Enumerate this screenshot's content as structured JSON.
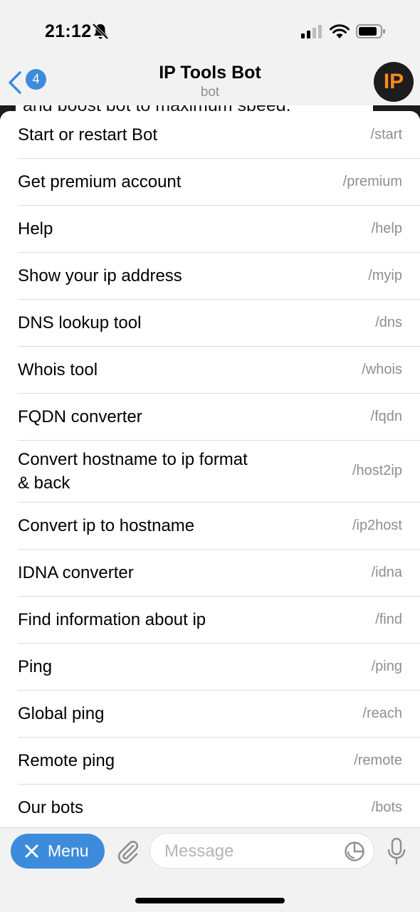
{
  "status_bar": {
    "time": "21:12"
  },
  "header": {
    "back_count": "4",
    "title": "IP Tools Bot",
    "subtitle": "bot",
    "avatar_text": "IP"
  },
  "chat_peek_text": "and boost bot to maximum speed.",
  "commands": [
    {
      "description": "Start or restart Bot",
      "command": "/start"
    },
    {
      "description": "Get premium account",
      "command": "/premium"
    },
    {
      "description": "Help",
      "command": "/help"
    },
    {
      "description": "Show your ip address",
      "command": "/myip"
    },
    {
      "description": "DNS lookup tool",
      "command": "/dns"
    },
    {
      "description": "Whois tool",
      "command": "/whois"
    },
    {
      "description": "FQDN converter",
      "command": "/fqdn"
    },
    {
      "description": "Convert hostname to ip format & back",
      "command": "/host2ip"
    },
    {
      "description": "Convert ip to hostname",
      "command": "/ip2host"
    },
    {
      "description": "IDNA converter",
      "command": "/idna"
    },
    {
      "description": "Find information about ip",
      "command": "/find"
    },
    {
      "description": "Ping",
      "command": "/ping"
    },
    {
      "description": "Global ping",
      "command": "/reach"
    },
    {
      "description": "Remote ping",
      "command": "/remote"
    },
    {
      "description": "Our bots",
      "command": "/bots"
    }
  ],
  "composer": {
    "menu_label": "Menu",
    "message_placeholder": "Message"
  },
  "colors": {
    "accent": "#3d8cdc",
    "avatar_bg": "#1d1d1d",
    "avatar_fg": "#ff8a1f",
    "secondary_text": "#8e8e93"
  },
  "icons": {
    "status": [
      "bell-muted-icon",
      "cellular-signal-icon",
      "wifi-icon",
      "battery-icon"
    ],
    "header": [
      "chevron-left-icon"
    ],
    "composer": [
      "close-icon",
      "paperclip-icon",
      "sticker-icon",
      "microphone-icon"
    ]
  }
}
